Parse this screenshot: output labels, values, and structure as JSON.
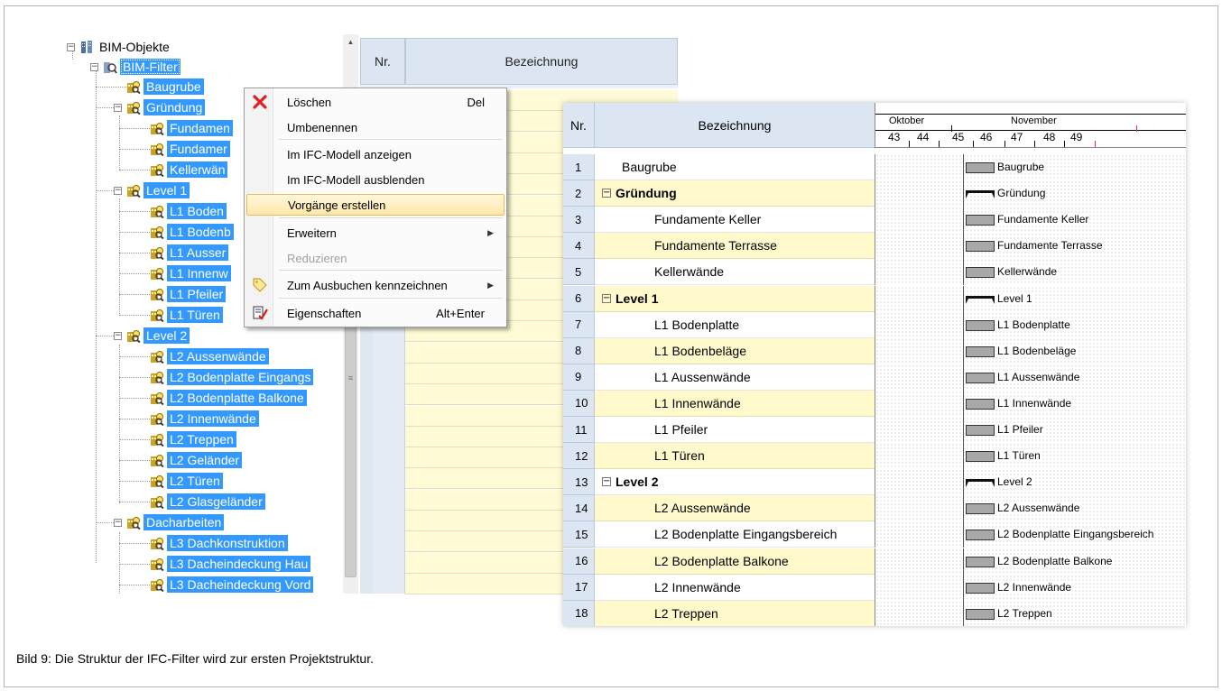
{
  "tree": {
    "root": "BIM-Objekte",
    "filter": "BIM-Filter",
    "nodes": [
      "Baugrube",
      "Gründung",
      "Fundamen",
      "Fundamer",
      "Kellerwän",
      "Level 1",
      "L1 Boden",
      "L1 Bodenb",
      "L1 Ausser",
      "L1 Innenw",
      "L1 Pfeiler",
      "L1 Türen",
      "Level 2",
      "L2 Aussenwände",
      "L2 Bodenplatte Eingangs",
      "L2 Bodenplatte Balkone",
      "L2 Innenwände",
      "L2 Treppen",
      "L2 Geländer",
      "L2 Türen",
      "L2 Glasgeländer",
      "Dacharbeiten",
      "L3 Dachkonstruktion",
      "L3 Dacheindeckung Hau",
      "L3 Dacheindeckung Vord"
    ]
  },
  "back_grid": {
    "nr_header": "Nr.",
    "bez_header": "Bezeichnung"
  },
  "context_menu": {
    "items": [
      {
        "label": "Löschen",
        "shortcut": "Del",
        "icon": "delete-x-icon"
      },
      {
        "label": "Umbenennen"
      },
      {
        "label": "Im IFC-Modell anzeigen"
      },
      {
        "label": "Im IFC-Modell ausblenden"
      },
      {
        "label": "Vorgänge erstellen",
        "highlighted": true
      },
      {
        "label": "Erweitern",
        "submenu": true
      },
      {
        "label": "Reduzieren",
        "disabled": true
      },
      {
        "label": "Zum Ausbuchen kennzeichnen",
        "submenu": true,
        "icon": "tag-icon"
      },
      {
        "label": "Eigenschaften",
        "shortcut": "Alt+Enter",
        "icon": "properties-icon"
      }
    ]
  },
  "gantt": {
    "nr_header": "Nr.",
    "bez_header": "Bezeichnung",
    "months": [
      "Oktober",
      "November"
    ],
    "weeks": [
      "43",
      "44",
      "45",
      "46",
      "47",
      "48",
      "49"
    ],
    "rows": [
      {
        "nr": "1",
        "name": "Baugrube",
        "summary": false
      },
      {
        "nr": "2",
        "name": "Gründung",
        "summary": true
      },
      {
        "nr": "3",
        "name": "Fundamente Keller",
        "summary": false
      },
      {
        "nr": "4",
        "name": "Fundamente Terrasse",
        "summary": false
      },
      {
        "nr": "5",
        "name": "Kellerwände",
        "summary": false
      },
      {
        "nr": "6",
        "name": "Level 1",
        "summary": true
      },
      {
        "nr": "7",
        "name": "L1 Bodenplatte",
        "summary": false
      },
      {
        "nr": "8",
        "name": "L1 Bodenbeläge",
        "summary": false
      },
      {
        "nr": "9",
        "name": "L1 Aussenwände",
        "summary": false
      },
      {
        "nr": "10",
        "name": "L1 Innenwände",
        "summary": false
      },
      {
        "nr": "11",
        "name": "L1 Pfeiler",
        "summary": false
      },
      {
        "nr": "12",
        "name": "L1 Türen",
        "summary": false
      },
      {
        "nr": "13",
        "name": "Level 2",
        "summary": true
      },
      {
        "nr": "14",
        "name": "L2 Aussenwände",
        "summary": false
      },
      {
        "nr": "15",
        "name": "L2 Bodenplatte Eingangsbereich",
        "summary": false
      },
      {
        "nr": "16",
        "name": "L2 Bodenplatte Balkone",
        "summary": false
      },
      {
        "nr": "17",
        "name": "L2 Innenwände",
        "summary": false
      },
      {
        "nr": "18",
        "name": "L2 Treppen",
        "summary": false
      }
    ]
  },
  "caption": "Bild 9: Die Struktur der IFC-Filter wird zur ersten Projektstruktur.",
  "colors": {
    "selection": "#3399ff",
    "header": "#dce6f2",
    "row_yellow": "#fff9cc",
    "menu_highlight": "#fde7a9"
  }
}
